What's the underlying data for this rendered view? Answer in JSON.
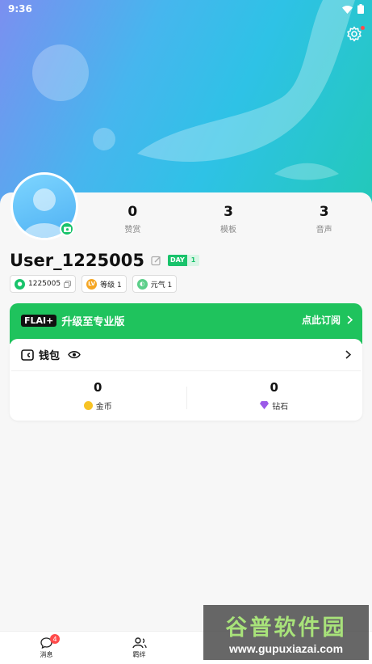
{
  "status_bar": {
    "time": "9:36"
  },
  "stats": [
    {
      "value": "0",
      "label": "赞赏"
    },
    {
      "value": "3",
      "label": "模板"
    },
    {
      "value": "3",
      "label": "音声"
    }
  ],
  "profile": {
    "username": "User_1225005",
    "day_label": "DAY",
    "day_count": "1"
  },
  "chips": [
    {
      "text": "1225005",
      "icon": "id-icon"
    },
    {
      "text": "等级 1",
      "icon": "level-icon",
      "icon_text": "LV"
    },
    {
      "text": "元气 1",
      "icon": "vitality-icon"
    }
  ],
  "pro_banner": {
    "badge": "FLAI+",
    "title": "升级至专业版",
    "action": "点此订阅"
  },
  "wallet": {
    "title": "钱包",
    "coins": {
      "value": "0",
      "label": "金币"
    },
    "diamonds": {
      "value": "0",
      "label": "钻石"
    }
  },
  "bottom_nav": [
    {
      "label": "消息",
      "badge": "4",
      "icon": "message-icon"
    },
    {
      "label": "羁绊",
      "icon": "contacts-icon"
    }
  ],
  "watermark": {
    "title": "谷普软件园",
    "url": "www.gupuxiazai.com"
  },
  "colors": {
    "accent": "#1fc35d",
    "badge": "#ff4a4a"
  }
}
